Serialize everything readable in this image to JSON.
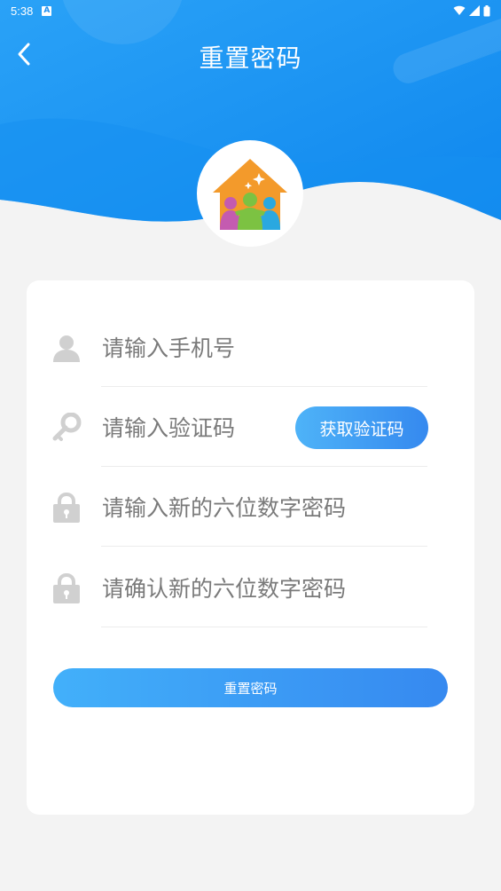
{
  "status_bar": {
    "time": "5:38",
    "icons": [
      "notification-a-icon",
      "wifi-icon",
      "signal-icon",
      "battery-icon"
    ]
  },
  "nav": {
    "back_icon": "chevron-left-icon",
    "title": "重置密码"
  },
  "logo": {
    "icon": "family-house-logo-icon"
  },
  "form": {
    "phone": {
      "placeholder": "请输入手机号",
      "value": "",
      "icon": "user-icon"
    },
    "code": {
      "placeholder": "请输入验证码",
      "value": "",
      "icon": "key-icon",
      "button_label": "获取验证码"
    },
    "new_password": {
      "placeholder": "请输入新的六位数字密码",
      "value": "",
      "icon": "lock-icon"
    },
    "confirm_password": {
      "placeholder": "请确认新的六位数字密码",
      "value": "",
      "icon": "lock-icon"
    },
    "submit_label": "重置密码"
  },
  "colors": {
    "header_blue": "#1a8ff2",
    "button_gradient_start": "#42b0fa",
    "button_gradient_end": "#3689f0",
    "background": "#f3f3f3",
    "icon_gray": "#d0d0d0"
  }
}
